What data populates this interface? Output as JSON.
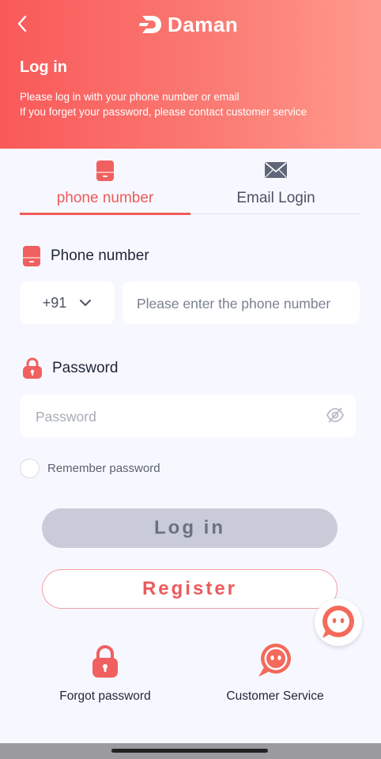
{
  "header": {
    "logo_text": "Daman",
    "title": "Log in",
    "subtitle_line1": "Please log in with your phone number or email",
    "subtitle_line2": "If you forget your password, please contact customer service"
  },
  "tabs": [
    {
      "label": "phone number",
      "icon": "phone-icon",
      "active": true
    },
    {
      "label": "Email Login",
      "icon": "mail-icon",
      "active": false
    }
  ],
  "phone_field": {
    "label": "Phone number",
    "country_code": "+91",
    "placeholder": "Please enter the phone number",
    "value": ""
  },
  "password_field": {
    "label": "Password",
    "placeholder": "Password",
    "value": ""
  },
  "remember": {
    "label": "Remember password",
    "checked": false
  },
  "buttons": {
    "login": "Log in",
    "register": "Register"
  },
  "bottom": {
    "forgot": "Forgot password",
    "customer_service": "Customer Service"
  },
  "colors": {
    "accent": "#f05a5a",
    "header_gradient_start": "#f95959",
    "header_gradient_end": "#ff9a8e",
    "login_button_disabled": "#c9ccd8",
    "page_background": "#f7f8ff"
  }
}
